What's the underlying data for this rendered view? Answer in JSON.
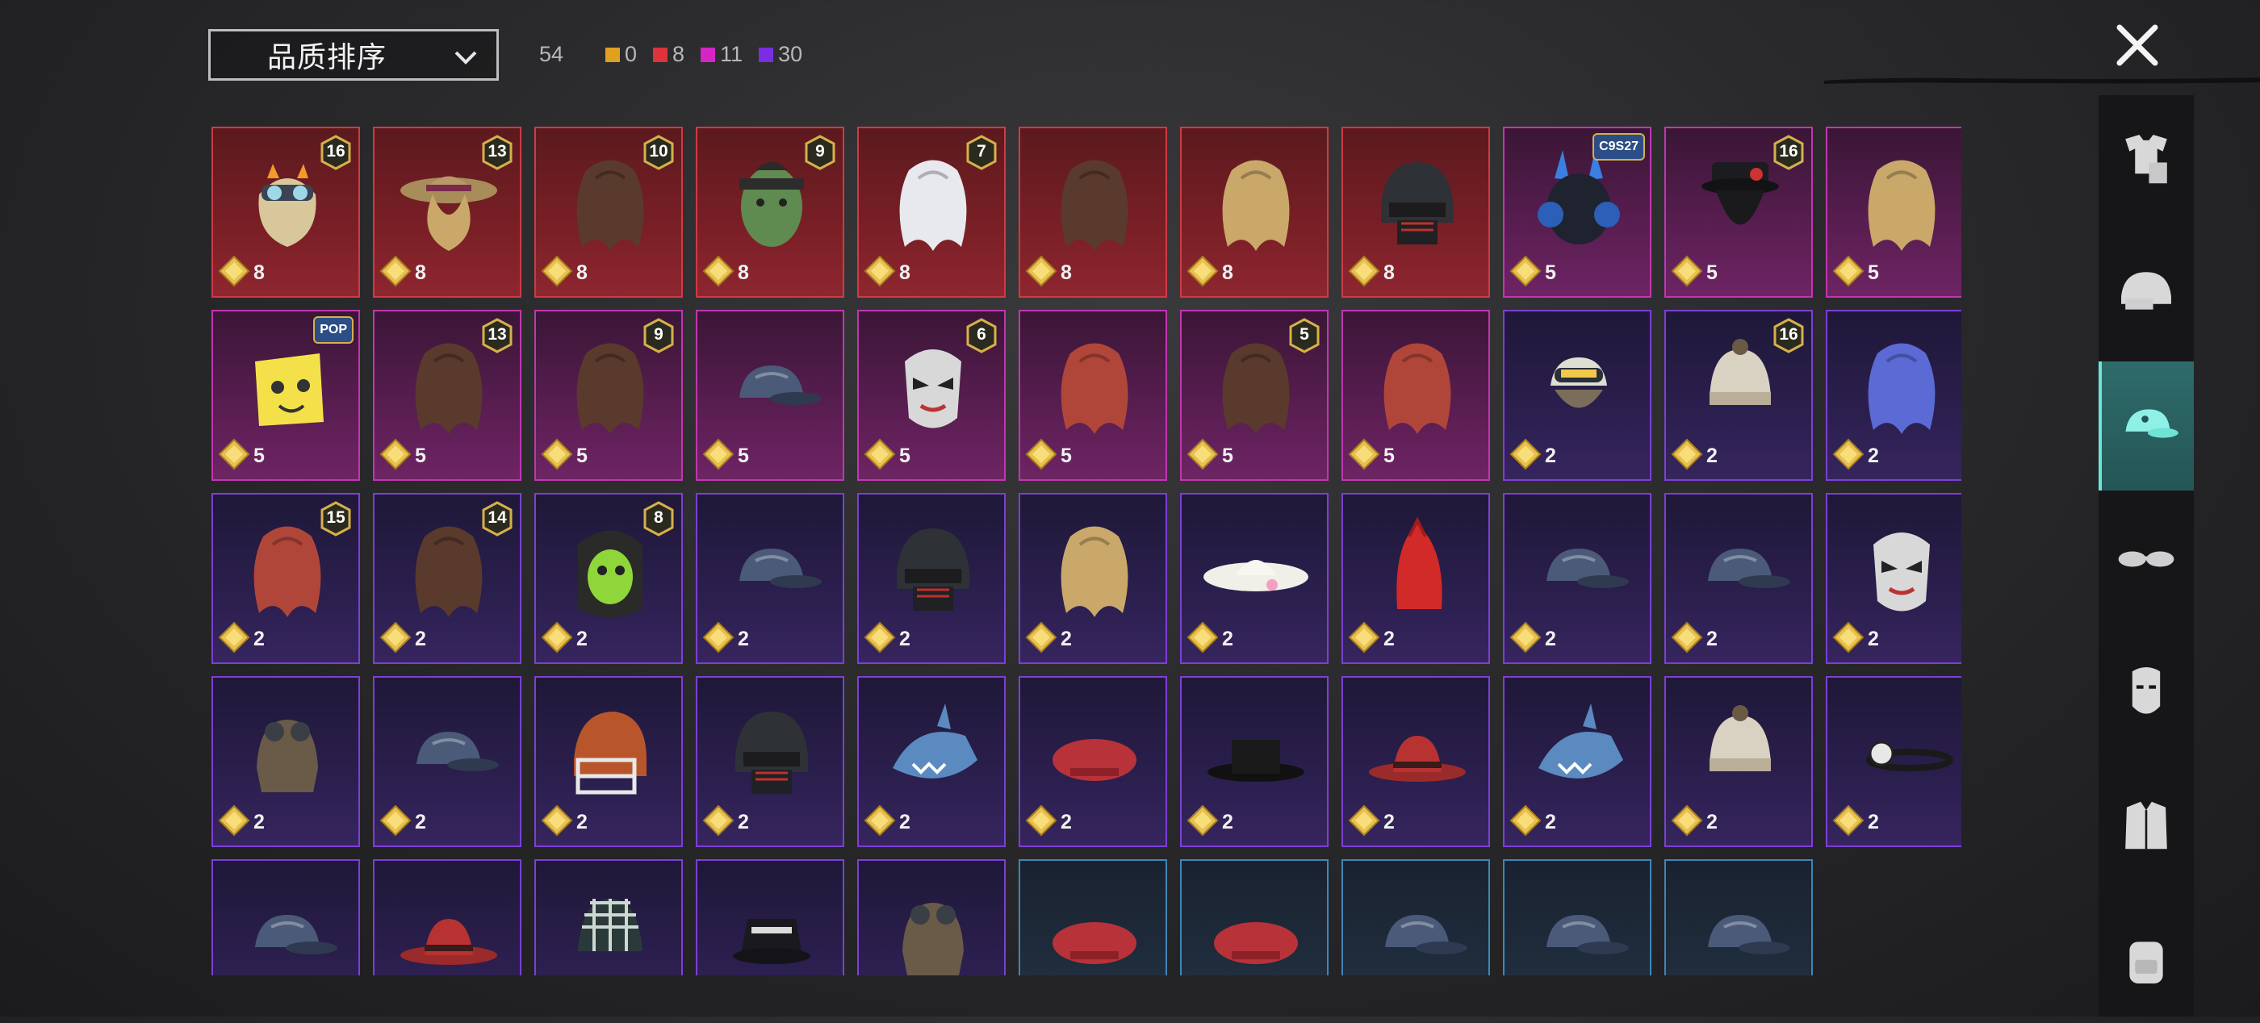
{
  "sort": {
    "label": "品质排序"
  },
  "counts": {
    "total": "54",
    "legend": [
      {
        "color": "#e0a020",
        "count": "0"
      },
      {
        "color": "#e0323a",
        "count": "8"
      },
      {
        "color": "#d326c4",
        "count": "11"
      },
      {
        "color": "#7a2ee0",
        "count": "30"
      }
    ]
  },
  "colors": {
    "accent": "#6ee3d6",
    "red": "#d03a44",
    "pink": "#c236b0",
    "purple": "#7c3fd6",
    "blue": "#3f86b8"
  },
  "items": [
    {
      "q": "red",
      "level": "16",
      "price": "8",
      "art": "cat-goggles"
    },
    {
      "q": "red",
      "level": "13",
      "price": "8",
      "art": "hat"
    },
    {
      "q": "red",
      "level": "10",
      "price": "8",
      "art": "hair"
    },
    {
      "q": "red",
      "level": "9",
      "price": "8",
      "art": "face"
    },
    {
      "q": "red",
      "level": "7",
      "price": "8",
      "art": "white-hair"
    },
    {
      "q": "red",
      "level": "",
      "price": "8",
      "art": "hair"
    },
    {
      "q": "red",
      "level": "",
      "price": "8",
      "art": "blond-hair"
    },
    {
      "q": "red",
      "level": "",
      "price": "8",
      "art": "helmet"
    },
    {
      "q": "pink",
      "level": "",
      "tag": "C9S27",
      "price": "5",
      "art": "headset"
    },
    {
      "q": "pink",
      "level": "16",
      "price": "5",
      "art": "dark-hat"
    },
    {
      "q": "pink",
      "level": "",
      "price": "5",
      "art": "blond-hair"
    },
    {
      "q": "pink",
      "level": "",
      "tag": "POP",
      "price": "5",
      "art": "box-face"
    },
    {
      "q": "pink",
      "level": "13",
      "price": "5",
      "art": "hair"
    },
    {
      "q": "pink",
      "level": "9",
      "price": "5",
      "art": "hair"
    },
    {
      "q": "pink",
      "level": "",
      "price": "5",
      "art": "cap"
    },
    {
      "q": "pink",
      "level": "6",
      "price": "5",
      "art": "mask"
    },
    {
      "q": "pink",
      "level": "",
      "price": "5",
      "art": "red-hair"
    },
    {
      "q": "pink",
      "level": "5",
      "price": "5",
      "art": "hair"
    },
    {
      "q": "pink",
      "level": "",
      "price": "5",
      "art": "red-hair"
    },
    {
      "q": "purple",
      "level": "",
      "price": "2",
      "art": "goggles"
    },
    {
      "q": "purple",
      "level": "16",
      "price": "2",
      "art": "beanie"
    },
    {
      "q": "purple",
      "level": "",
      "price": "2",
      "art": "blue-hair"
    },
    {
      "q": "purple",
      "level": "15",
      "price": "2",
      "art": "red-hair"
    },
    {
      "q": "purple",
      "level": "14",
      "price": "2",
      "art": "hair"
    },
    {
      "q": "purple",
      "level": "8",
      "price": "2",
      "art": "green-face"
    },
    {
      "q": "purple",
      "level": "",
      "price": "2",
      "art": "cap"
    },
    {
      "q": "purple",
      "level": "",
      "price": "2",
      "art": "helmet"
    },
    {
      "q": "purple",
      "level": "",
      "price": "2",
      "art": "blond-hair"
    },
    {
      "q": "purple",
      "level": "",
      "price": "2",
      "art": "sunhat"
    },
    {
      "q": "purple",
      "level": "",
      "price": "2",
      "art": "red-mohawk"
    },
    {
      "q": "purple",
      "level": "",
      "price": "2",
      "art": "cap"
    },
    {
      "q": "purple",
      "level": "",
      "price": "2",
      "art": "cap"
    },
    {
      "q": "purple",
      "level": "",
      "price": "2",
      "art": "mask"
    },
    {
      "q": "purple",
      "level": "",
      "price": "2",
      "art": "aviator"
    },
    {
      "q": "purple",
      "level": "",
      "price": "2",
      "art": "cap"
    },
    {
      "q": "purple",
      "level": "",
      "price": "2",
      "art": "football-helmet"
    },
    {
      "q": "purple",
      "level": "",
      "price": "2",
      "art": "helmet"
    },
    {
      "q": "purple",
      "level": "",
      "price": "2",
      "art": "shark"
    },
    {
      "q": "purple",
      "level": "",
      "price": "2",
      "art": "beret"
    },
    {
      "q": "purple",
      "level": "",
      "price": "2",
      "art": "tophat"
    },
    {
      "q": "purple",
      "level": "",
      "price": "2",
      "art": "fedora"
    },
    {
      "q": "purple",
      "level": "",
      "price": "2",
      "art": "shark"
    },
    {
      "q": "purple",
      "level": "",
      "price": "2",
      "art": "beanie"
    },
    {
      "q": "purple",
      "level": "",
      "price": "2",
      "art": "headlamp"
    },
    {
      "q": "purple",
      "level": "",
      "price": "",
      "art": "cap"
    },
    {
      "q": "purple",
      "level": "",
      "price": "",
      "art": "fedora"
    },
    {
      "q": "purple",
      "level": "",
      "price": "",
      "art": "net-cap"
    },
    {
      "q": "purple",
      "level": "",
      "price": "",
      "art": "bucket"
    },
    {
      "q": "purple",
      "level": "",
      "price": "",
      "art": "aviator"
    },
    {
      "q": "blue",
      "level": "",
      "price": "",
      "art": "beret"
    },
    {
      "q": "blue",
      "level": "",
      "price": "",
      "art": "beret"
    },
    {
      "q": "blue",
      "level": "",
      "price": "",
      "art": "cap"
    },
    {
      "q": "blue",
      "level": "",
      "price": "",
      "art": "cap"
    },
    {
      "q": "blue",
      "level": "",
      "price": "",
      "art": "cap"
    }
  ],
  "sidebar": [
    {
      "name": "outfit-icon",
      "active": false
    },
    {
      "name": "helmet-icon",
      "active": false
    },
    {
      "name": "hat-icon",
      "active": true
    },
    {
      "name": "glasses-icon",
      "active": false
    },
    {
      "name": "face-icon",
      "active": false
    },
    {
      "name": "jacket-icon",
      "active": false
    },
    {
      "name": "backpack-icon",
      "active": false
    }
  ]
}
